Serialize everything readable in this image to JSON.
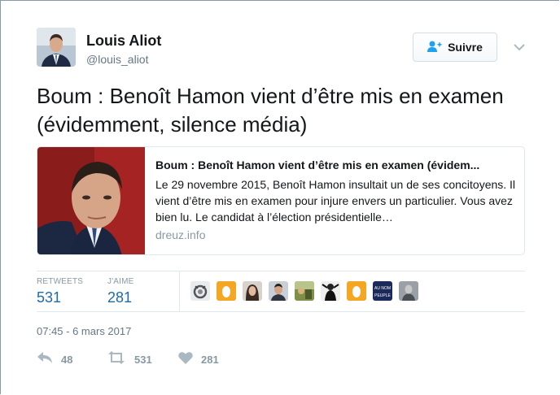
{
  "tweet": {
    "author": {
      "name": "Louis Aliot",
      "handle": "@louis_aliot"
    },
    "follow_label": "Suivre",
    "text": "Boum : Benoît Hamon vient d’être mis en examen (évidemment, silence média)",
    "timestamp": "07:45 - 6 mars 2017"
  },
  "card": {
    "title": "Boum : Benoît Hamon vient d’être mis en examen (évidem...",
    "description": "Le 29 novembre 2015, Benoît Hamon insultait un de ses concitoyens. Il vient d’être mis en examen pour injure envers un particulier. Vous avez bien lu. Le candidat à l’élection présidentielle…",
    "domain": "dreuz.info"
  },
  "stats": {
    "retweets_label": "RETWEETS",
    "retweets_value": "531",
    "likes_label": "J'AIME",
    "likes_value": "281"
  },
  "likers": [
    {
      "icon": "ring-avatar"
    },
    {
      "icon": "egg-avatar"
    },
    {
      "icon": "woman-portrait-avatar"
    },
    {
      "icon": "man-portrait-avatar"
    },
    {
      "icon": "outdoor-avatar"
    },
    {
      "icon": "bw-figure-avatar"
    },
    {
      "icon": "egg-avatar"
    },
    {
      "icon": "au-nom-du-peuple-avatar",
      "text_line1": "AU NOM",
      "text_line2": "PEUPLE"
    },
    {
      "icon": "gray-portrait-avatar"
    }
  ],
  "actions": {
    "reply_icon": "reply-icon",
    "reply_count": "48",
    "retweet_icon": "retweet-icon",
    "retweet_count": "531",
    "like_icon": "heart-icon",
    "like_count": "281"
  },
  "colors": {
    "text": "#14171a",
    "secondary": "#657786",
    "muted": "#8899a6",
    "link": "#1b6ca8",
    "border": "#e1e8ed",
    "egg": "#f5a623"
  }
}
